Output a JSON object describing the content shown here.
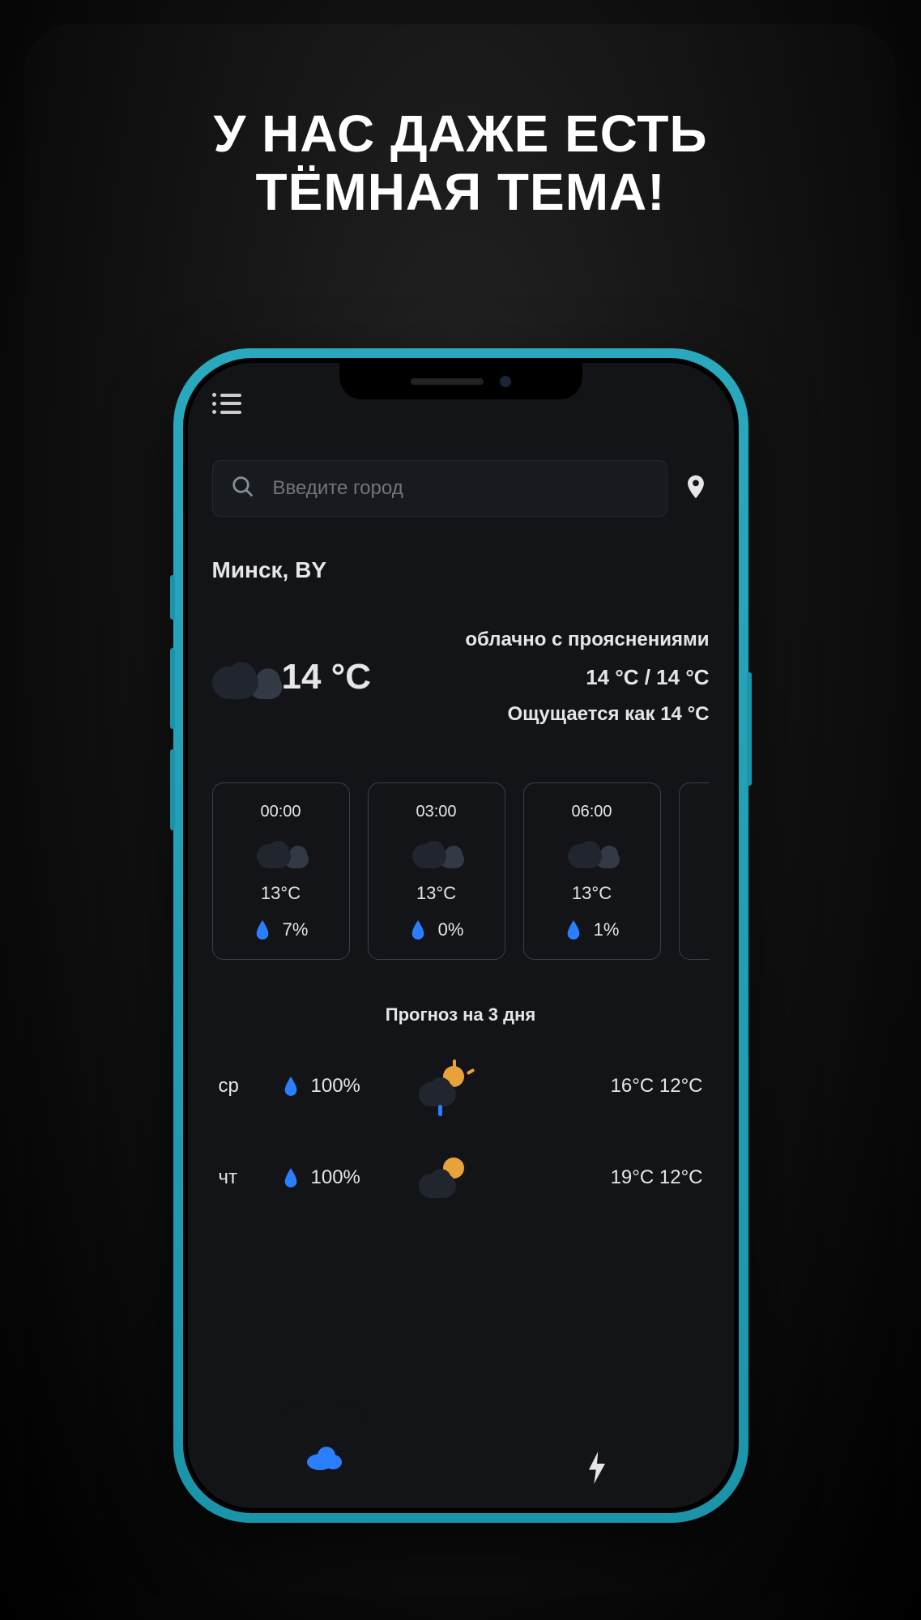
{
  "headline_line1": "У НАС ДАЖЕ ЕСТЬ",
  "headline_line2": "ТЁМНАЯ ТЕМА!",
  "search": {
    "placeholder": "Введите город"
  },
  "location": "Минск, BY",
  "current": {
    "temp": "14 °C",
    "description": "облачно с прояснениями",
    "high_low": "14 °C / 14 °C",
    "feels_like": "Ощущается как 14 °C"
  },
  "hourly": [
    {
      "time": "00:00",
      "temp": "13°C",
      "precip": "7%"
    },
    {
      "time": "03:00",
      "temp": "13°C",
      "precip": "0%"
    },
    {
      "time": "06:00",
      "temp": "13°C",
      "precip": "1%"
    }
  ],
  "forecast_title": "Прогноз на 3 дня",
  "daily": [
    {
      "day": "ср",
      "precip": "100%",
      "icon": "sun-rain",
      "hi": "16°C",
      "lo": "12°C"
    },
    {
      "day": "чт",
      "precip": "100%",
      "icon": "sun-cloud",
      "hi": "19°C",
      "lo": "12°C"
    }
  ]
}
